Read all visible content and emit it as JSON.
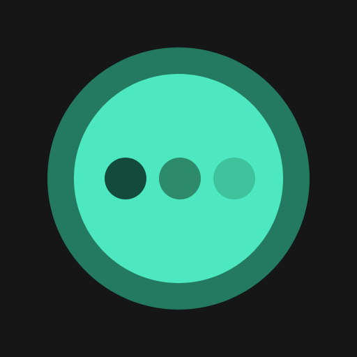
{
  "icon": {
    "name": "more-options-icon",
    "colors": {
      "background": "#161616",
      "ring": "#237a60",
      "disc": "#4de8bf",
      "dots": [
        "#134a3b",
        "#2d8a6a",
        "#40c29c"
      ]
    }
  }
}
